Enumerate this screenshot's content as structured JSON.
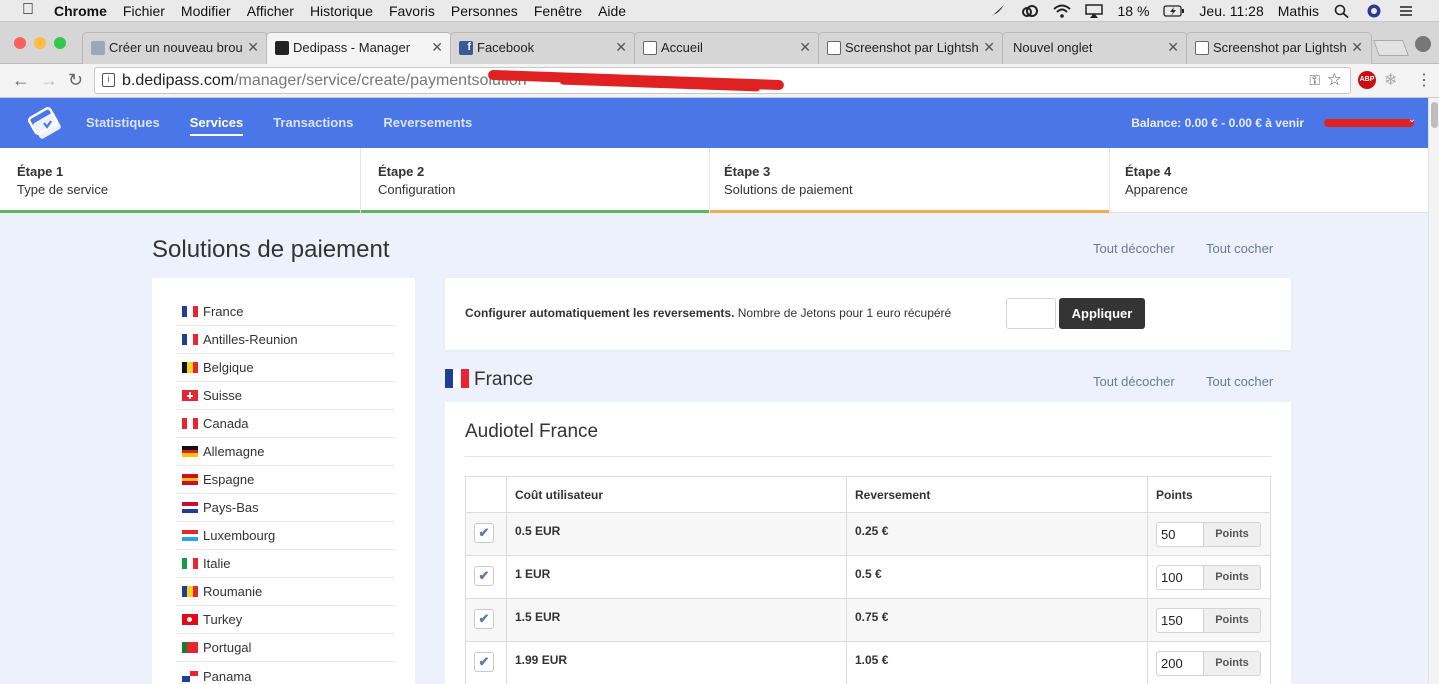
{
  "menubar": {
    "app": "Chrome",
    "items": [
      "Fichier",
      "Modifier",
      "Afficher",
      "Historique",
      "Favoris",
      "Personnes",
      "Fenêtre",
      "Aide"
    ],
    "battery": "18 %",
    "clock": "Jeu. 11:28",
    "user": "Mathis"
  },
  "tabs": [
    {
      "title": "Créer un nouveau brou",
      "favicon_color": "#9aa8b8"
    },
    {
      "title": "Dedipass - Manager",
      "favicon_color": "#222222"
    },
    {
      "title": "Facebook",
      "favicon_color": "#3b5998"
    },
    {
      "title": "Accueil",
      "favicon_color": "#ffffff"
    },
    {
      "title": "Screenshot par Lightsh",
      "favicon_color": "#ffffff"
    },
    {
      "title": "Nouvel onglet",
      "favicon_color": "#d6d6d6"
    },
    {
      "title": "Screenshot par Lightsh",
      "favicon_color": "#ffffff"
    }
  ],
  "address": {
    "host": "b.dedipass.com",
    "path": "/manager/service/create/paymentsolution"
  },
  "header": {
    "nav": [
      "Statistiques",
      "Services",
      "Transactions",
      "Reversements"
    ],
    "active_nav": "Services",
    "balance": "Balance: 0.00 € - 0.00 € à venir",
    "brand_color": "#4a76e8"
  },
  "steps": [
    {
      "num": "Étape 1",
      "label": "Type de service",
      "bar_color": "#5cb85c"
    },
    {
      "num": "Étape 2",
      "label": "Configuration",
      "bar_color": "#5cb85c"
    },
    {
      "num": "Étape 3",
      "label": "Solutions de paiement",
      "bar_color": "#f0ad4e"
    },
    {
      "num": "Étape 4",
      "label": "Apparence",
      "bar_color": ""
    }
  ],
  "page": {
    "title": "Solutions de paiement",
    "uncheck_all": "Tout décocher",
    "check_all": "Tout cocher"
  },
  "countries": [
    {
      "name": "France",
      "flag": [
        "#1f3f96",
        "#ffffff",
        "#e8242f"
      ],
      "dir": "v"
    },
    {
      "name": "Antilles-Reunion",
      "flag": [
        "#1f3f96",
        "#ffffff",
        "#e8242f"
      ],
      "dir": "v"
    },
    {
      "name": "Belgique",
      "flag": [
        "#111111",
        "#f6d520",
        "#e8242f"
      ],
      "dir": "v"
    },
    {
      "name": "Suisse",
      "flag": [
        "#e8242f"
      ],
      "dir": "cross"
    },
    {
      "name": "Canada",
      "flag": [
        "#e8242f",
        "#ffffff",
        "#e8242f"
      ],
      "dir": "v"
    },
    {
      "name": "Allemagne",
      "flag": [
        "#111111",
        "#dd1f1f",
        "#f6c500"
      ],
      "dir": "h"
    },
    {
      "name": "Espagne",
      "flag": [
        "#c8102e",
        "#f6c500",
        "#c8102e"
      ],
      "dir": "h"
    },
    {
      "name": "Pays-Bas",
      "flag": [
        "#c8102e",
        "#ffffff",
        "#1f3f96"
      ],
      "dir": "h"
    },
    {
      "name": "Luxembourg",
      "flag": [
        "#e8242f",
        "#ffffff",
        "#2ea3e0"
      ],
      "dir": "h"
    },
    {
      "name": "Italie",
      "flag": [
        "#1a9a45",
        "#ffffff",
        "#e8242f"
      ],
      "dir": "v"
    },
    {
      "name": "Roumanie",
      "flag": [
        "#1f3f96",
        "#f6d520",
        "#e8242f"
      ],
      "dir": "v"
    },
    {
      "name": "Turkey",
      "flag": [
        "#e30a17"
      ],
      "dir": "solid"
    },
    {
      "name": "Portugal",
      "flag": [
        "#137c2e",
        "#e8242f",
        "#e8242f"
      ],
      "dir": "v"
    },
    {
      "name": "Panama",
      "flag": [
        "#ffffff",
        "#e8242f",
        "#1f3f96",
        "#ffffff"
      ],
      "dir": "q"
    }
  ],
  "config": {
    "bold_text": "Configurer automatiquement les reversements.",
    "text": " Nombre de Jetons pour 1 euro récupéré",
    "button": "Appliquer"
  },
  "section": {
    "title": "France",
    "uncheck_all": "Tout décocher",
    "check_all": "Tout cocher"
  },
  "panel": {
    "title": "Audiotel France",
    "columns": [
      "Coût utilisateur",
      "Reversement",
      "Points"
    ],
    "points_unit": "Points",
    "rows": [
      {
        "cost": "0.5 EUR",
        "payout": "0.25 €",
        "points": "50",
        "checked": true
      },
      {
        "cost": "1 EUR",
        "payout": "0.5 €",
        "points": "100",
        "checked": true
      },
      {
        "cost": "1.5 EUR",
        "payout": "0.75 €",
        "points": "150",
        "checked": true
      },
      {
        "cost": "1.99 EUR",
        "payout": "1.05 €",
        "points": "200",
        "checked": true
      }
    ]
  }
}
